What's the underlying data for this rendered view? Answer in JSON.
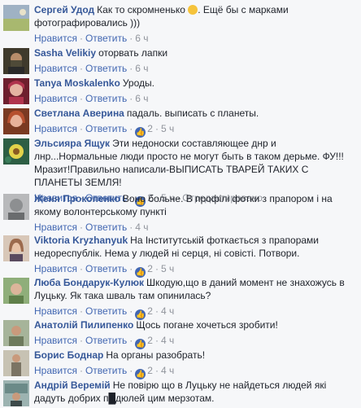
{
  "actions": {
    "like": "Нравится",
    "reply": "Ответить",
    "dot": "·"
  },
  "comments": [
    {
      "author": "Сергей Удод",
      "text": "Как то скромненько",
      "text2": ". Ещё бы с марками фотографировались )))",
      "time": "6 ч",
      "avatar": "avatar-landscape",
      "avatar_color": "#a8b86f"
    },
    {
      "author": "Sasha Velikiy",
      "text": "оторвать лапки",
      "time": "6 ч",
      "avatar": "avatar-beard",
      "avatar_color": "#4f4a38"
    },
    {
      "author": "Tanya Moskalenko",
      "text": "Уроды.",
      "time": "6 ч",
      "avatar": "avatar-pink",
      "avatar_color": "#b0334d"
    },
    {
      "author": "Светлана Аверина",
      "text": "падаль. выписать с планеты.",
      "time": "5 ч",
      "reactions": "2",
      "avatar": "avatar-red-hair",
      "avatar_color": "#b6502f"
    },
    {
      "author": "Эльсияра Ящук",
      "text": "Эти недоноски составляющее днр и лнр...Нормальные люди просто не могут быть в таком дерьме. ФУ!!!Мразит!Правильно написали-ВЫПИСАТЬ ТВАРЕЙ ТАКИХ С ПЛАНЕТЫ ЗЕМЛЯ!",
      "time": "5 ч",
      "reactions": "2",
      "edited": "Отредактировано",
      "avatar": "avatar-flower",
      "avatar_color": "#3a7d5a"
    },
    {
      "author": "Женя Прокопенко",
      "text": "Воно больне. В профілі фотки з прапором і на якому волонтерському пункті",
      "time": "4 ч",
      "avatar": "avatar-gray",
      "avatar_color": "#8d8f91"
    },
    {
      "author": "Viktoria Kryzhanyuk",
      "text": "На Інститутській фоткається з прапорами недореспублік. Нема у людей ні серця, ні совісті. Потвори.",
      "time": "5 ч",
      "reactions": "2",
      "avatar": "avatar-woman",
      "avatar_color": "#9c6a4d"
    },
    {
      "author": "Люба Бондарук-Кулюк",
      "text": "Шкодую,що в даний момент не знахожусь в Луцьку. Як така шваль там опинилась?",
      "time": "4 ч",
      "reactions": "2",
      "avatar": "avatar-green",
      "avatar_color": "#5f7f4a"
    },
    {
      "author": "Анатолій Пилипенко",
      "text": "Щось погане хочеться зробити!",
      "time": "4 ч",
      "reactions": "2",
      "avatar": "avatar-man-outdoor",
      "avatar_color": "#6d7a5c"
    },
    {
      "author": "Борис Боднар",
      "text": "На органы разобрать!",
      "time": "4 ч",
      "reactions": "2",
      "avatar": "avatar-man-stand",
      "avatar_color": "#7b7464"
    },
    {
      "author": "Андрій Веремій",
      "text": "Не повірю що в Луцьку не найдеться людей які дадуть добрих п█дюлей цим мерзотам.",
      "time": "",
      "avatar": "avatar-shop",
      "avatar_color": "#6b8a88"
    }
  ]
}
